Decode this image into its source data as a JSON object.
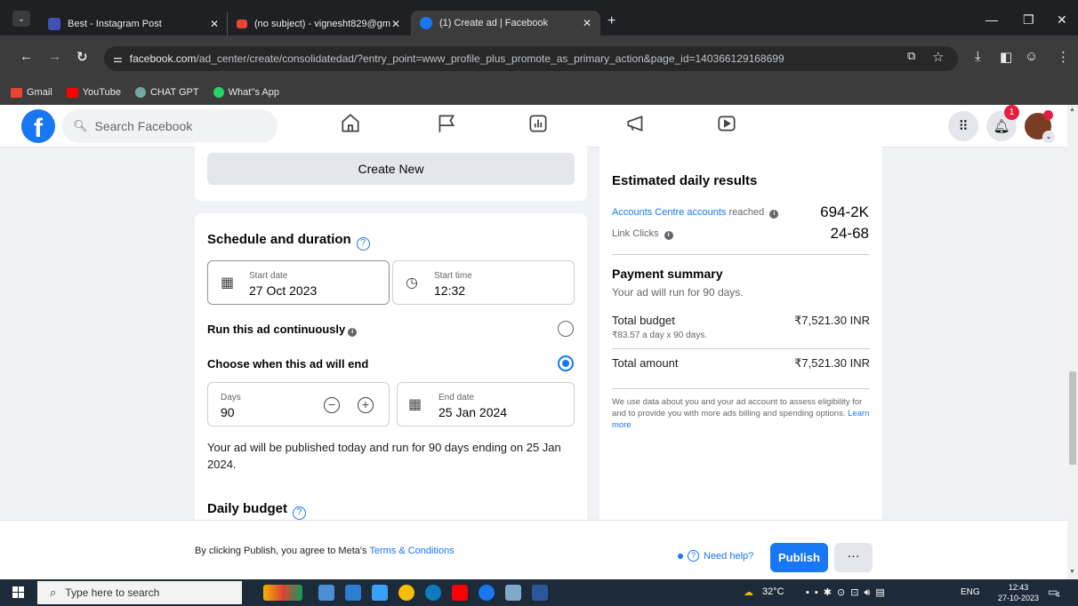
{
  "browser": {
    "tabs": [
      {
        "title": "Best - Instagram Post",
        "active": false
      },
      {
        "title": "(no subject) - vignesht829@gm",
        "active": false
      },
      {
        "title": "(1) Create ad | Facebook",
        "active": true
      }
    ],
    "url_host": "facebook.com",
    "url_path": "/ad_center/create/consolidatedad/?entry_point=www_profile_plus_promote_as_primary_action&page_id=140366129168699",
    "bookmarks": [
      "Gmail",
      "YouTube",
      "CHAT GPT",
      "What''s App"
    ]
  },
  "fb_header": {
    "logo": "f",
    "search_placeholder": "Search Facebook",
    "notification_count": "1"
  },
  "left": {
    "create_new_label": "Create New",
    "schedule_title": "Schedule and duration",
    "start_date_label": "Start date",
    "start_date_value": "27 Oct 2023",
    "start_time_label": "Start time",
    "start_time_value": "12:32",
    "run_continuously_label": "Run this ad continuously",
    "choose_end_label": "Choose when this ad will end",
    "days_label": "Days",
    "days_value": "90",
    "end_date_label": "End date",
    "end_date_value": "25 Jan 2024",
    "publish_description": "Your ad will be published today and run for 90 days ending on 25 Jan 2024.",
    "daily_budget_title": "Daily budget"
  },
  "right": {
    "estimated_title": "Estimated daily results",
    "accounts_reached_link": "Accounts Centre accounts",
    "accounts_reached_suffix": "reached",
    "accounts_reached_value": "694-2K",
    "link_clicks_label": "Link Clicks",
    "link_clicks_value": "24-68",
    "payment_title": "Payment summary",
    "payment_sub": "Your ad will run for 90 days.",
    "total_budget_label": "Total budget",
    "total_budget_sub": "₹83.57 a day x 90 days.",
    "total_budget_value": "₹7,521.30 INR",
    "total_amount_label": "Total amount",
    "total_amount_value": "₹7,521.30 INR",
    "note_text": "We use data about you and your ad account to assess eligibility for and to provide you with more ads billing and spending options.",
    "note_link": "Learn more"
  },
  "footer": {
    "terms_prefix": "By clicking Publish, you agree to Meta's",
    "terms_link": "Terms & Conditions",
    "need_help": "Need help?",
    "publish_label": "Publish",
    "more_label": "···"
  },
  "taskbar": {
    "search_placeholder": "Type here to search",
    "temperature": "32°C",
    "lang": "ENG",
    "time": "12:43",
    "date": "27-10-2023",
    "notif_count": "4"
  },
  "colors": {
    "fb_blue": "#1877f2",
    "page_bg": "#f0f2f5",
    "chrome_dark": "#3c3c3c"
  }
}
